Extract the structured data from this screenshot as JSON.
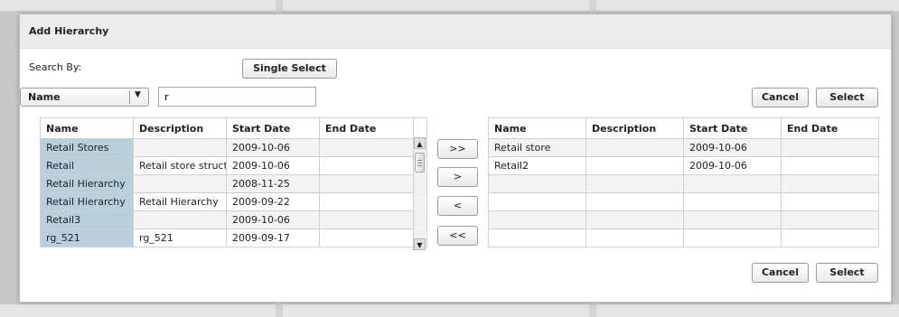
{
  "dialog": {
    "title": "Add Hierarchy"
  },
  "search": {
    "label": "Search By:",
    "field_value": "Name",
    "query_value": "r"
  },
  "buttons": {
    "single_select": "Single Select",
    "cancel": "Cancel",
    "select": "Select",
    "move_all_right": ">>",
    "move_right": ">",
    "move_left": "<",
    "move_all_left": "<<"
  },
  "available": {
    "columns": [
      "Name",
      "Description",
      "Start Date",
      "End Date"
    ],
    "rows": [
      {
        "name": "Retail Stores",
        "description": "",
        "start": "2009-10-06",
        "end": ""
      },
      {
        "name": "Retail",
        "description": "Retail store structure",
        "start": "2009-10-06",
        "end": ""
      },
      {
        "name": "Retail Hierarchy",
        "description": "",
        "start": "2008-11-25",
        "end": ""
      },
      {
        "name": "Retail Hierarchy",
        "description": "Retail Hierarchy",
        "start": "2009-09-22",
        "end": ""
      },
      {
        "name": "Retail3",
        "description": "",
        "start": "2009-10-06",
        "end": ""
      },
      {
        "name": "rg_521",
        "description": "rg_521",
        "start": "2009-09-17",
        "end": ""
      }
    ]
  },
  "selected": {
    "columns": [
      "Name",
      "Description",
      "Start Date",
      "End Date"
    ],
    "rows": [
      {
        "name": "Retail store",
        "description": "",
        "start": "2009-10-06",
        "end": ""
      },
      {
        "name": "Retail2",
        "description": "",
        "start": "2009-10-06",
        "end": ""
      },
      {
        "name": "",
        "description": "",
        "start": "",
        "end": ""
      },
      {
        "name": "",
        "description": "",
        "start": "",
        "end": ""
      },
      {
        "name": "",
        "description": "",
        "start": "",
        "end": ""
      },
      {
        "name": "",
        "description": "",
        "start": "",
        "end": ""
      }
    ]
  },
  "icons": {
    "dropdown": "chevron-down-icon",
    "scroll_up": "arrow-up-icon",
    "scroll_down": "arrow-down-icon"
  }
}
